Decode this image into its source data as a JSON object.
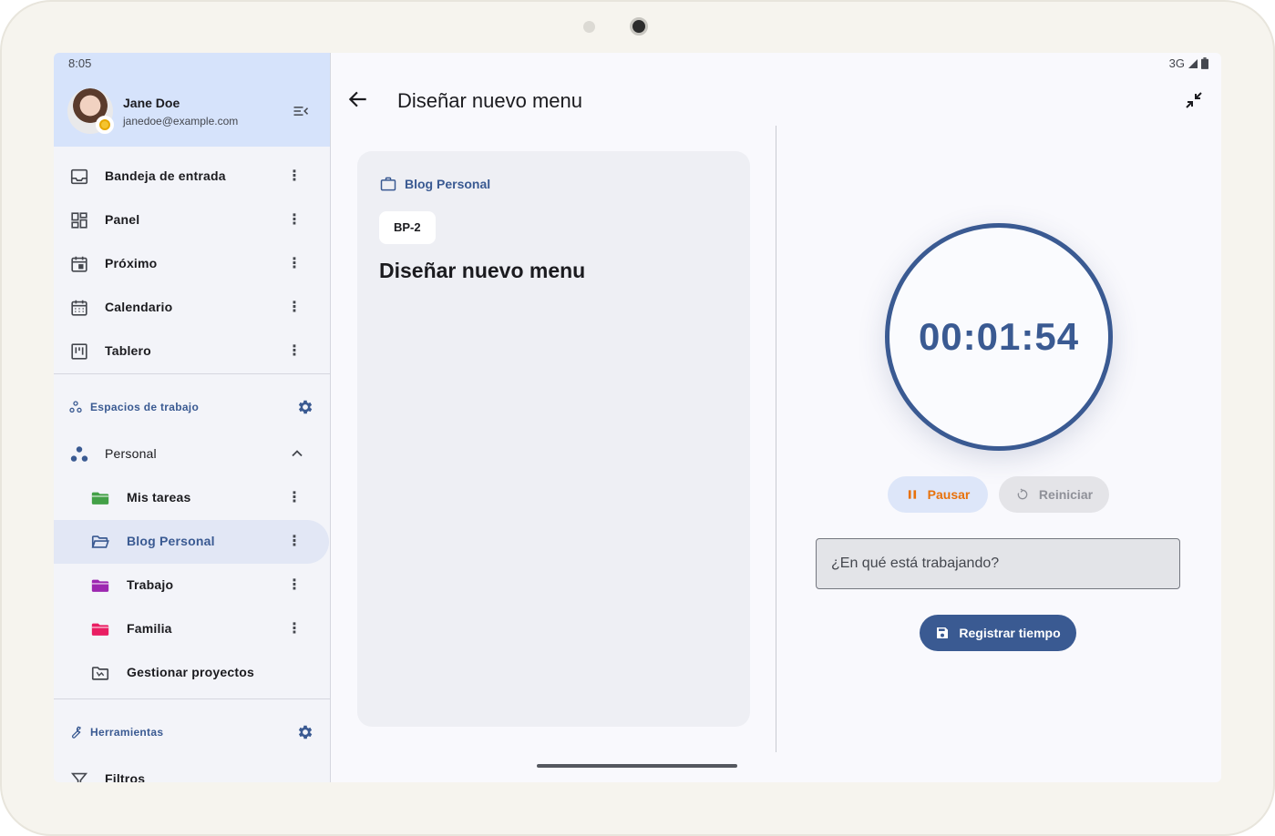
{
  "status": {
    "time": "8:05",
    "network": "3G"
  },
  "user": {
    "name": "Jane Doe",
    "email": "janedoe@example.com"
  },
  "nav": {
    "items": [
      {
        "label": "Bandeja de entrada",
        "icon": "inbox-icon"
      },
      {
        "label": "Panel",
        "icon": "dashboard-icon"
      },
      {
        "label": "Próximo",
        "icon": "calendar-today-icon"
      },
      {
        "label": "Calendario",
        "icon": "calendar-month-icon"
      },
      {
        "label": "Tablero",
        "icon": "board-icon"
      }
    ]
  },
  "workspaces": {
    "section_label": "Espacios de trabajo",
    "personal_label": "Personal",
    "projects": [
      {
        "label": "Mis tareas",
        "color": "#43a047"
      },
      {
        "label": "Blog Personal",
        "color": "#3a5a92"
      },
      {
        "label": "Trabajo",
        "color": "#9c27b0"
      },
      {
        "label": "Familia",
        "color": "#e91e63"
      }
    ],
    "manage_label": "Gestionar proyectos"
  },
  "tools": {
    "section_label": "Herramientas",
    "filters_label": "Filtros"
  },
  "main": {
    "title": "Diseñar nuevo menu",
    "card": {
      "project": "Blog Personal",
      "task_id": "BP-2",
      "task_title": "Diseñar nuevo menu"
    },
    "timer": {
      "display": "00:01:54",
      "pause_label": "Pausar",
      "reset_label": "Reiniciar",
      "input_placeholder": "¿En qué está trabajando?",
      "log_label": "Registrar tiempo"
    }
  },
  "colors": {
    "accent": "#3a5a92",
    "pause": "#e8710a",
    "header_bg": "#d6e3fb"
  }
}
